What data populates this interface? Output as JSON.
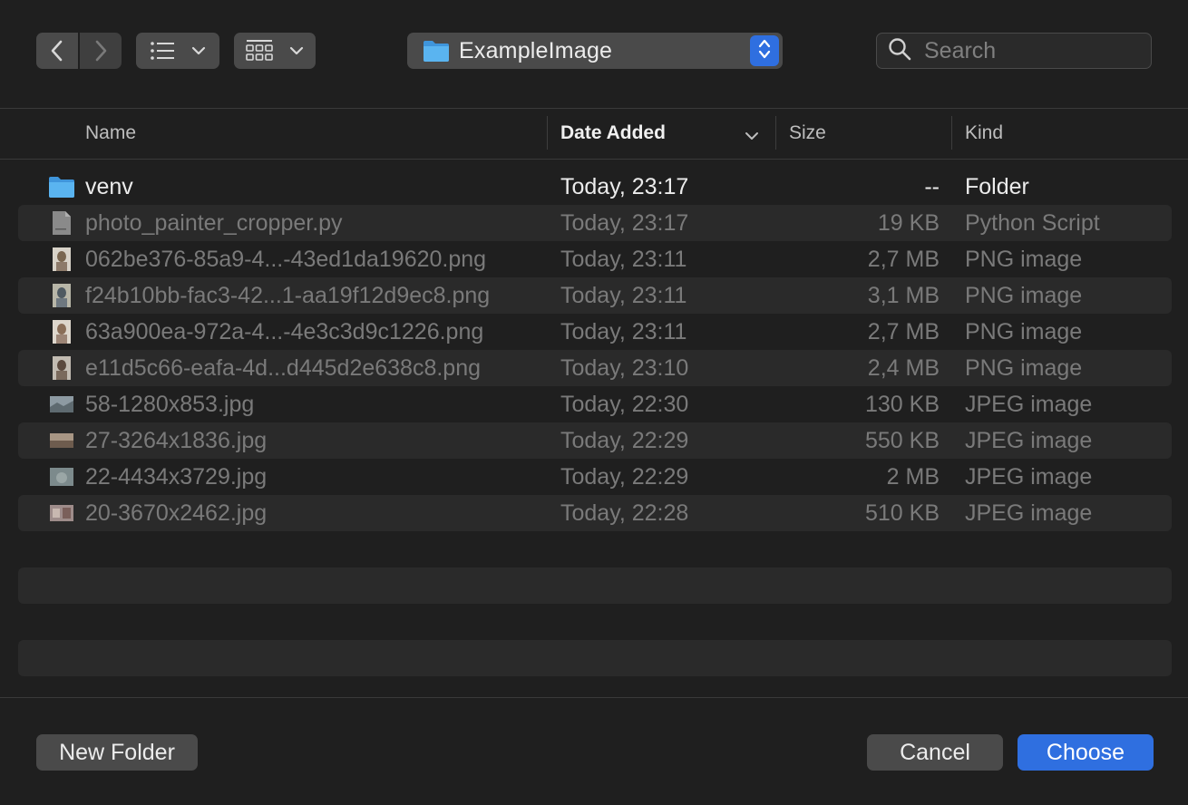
{
  "toolbar": {
    "back_icon": "chevron-left-icon",
    "forward_icon": "chevron-right-icon",
    "list_view_icon": "list-icon",
    "grid_view_icon": "grid-icon",
    "folder": "ExampleImage",
    "search_placeholder": "Search"
  },
  "columns": {
    "name": "Name",
    "date_added": "Date Added",
    "size": "Size",
    "kind": "Kind"
  },
  "files": [
    {
      "name": "venv",
      "date": "Today, 23:17",
      "size": "--",
      "kind": "Folder",
      "icon": "folder-icon",
      "enabled": true
    },
    {
      "name": "photo_painter_cropper.py",
      "date": "Today, 23:17",
      "size": "19 KB",
      "kind": "Python Script",
      "icon": "document-icon",
      "enabled": false
    },
    {
      "name": "062be376-85a9-4...-43ed1da19620.png",
      "date": "Today, 23:11",
      "size": "2,7 MB",
      "kind": "PNG image",
      "icon": "image-thumbnail-icon",
      "enabled": false
    },
    {
      "name": "f24b10bb-fac3-42...1-aa19f12d9ec8.png",
      "date": "Today, 23:11",
      "size": "3,1 MB",
      "kind": "PNG image",
      "icon": "image-thumbnail-icon",
      "enabled": false
    },
    {
      "name": "63a900ea-972a-4...-4e3c3d9c1226.png",
      "date": "Today, 23:11",
      "size": "2,7 MB",
      "kind": "PNG image",
      "icon": "image-thumbnail-icon",
      "enabled": false
    },
    {
      "name": "e11d5c66-eafa-4d...d445d2e638c8.png",
      "date": "Today, 23:10",
      "size": "2,4 MB",
      "kind": "PNG image",
      "icon": "image-thumbnail-icon",
      "enabled": false
    },
    {
      "name": "58-1280x853.jpg",
      "date": "Today, 22:30",
      "size": "130 KB",
      "kind": "JPEG image",
      "icon": "landscape-thumbnail-icon",
      "enabled": false
    },
    {
      "name": "27-3264x1836.jpg",
      "date": "Today, 22:29",
      "size": "550 KB",
      "kind": "JPEG image",
      "icon": "landscape-thumbnail-icon",
      "enabled": false
    },
    {
      "name": "22-4434x3729.jpg",
      "date": "Today, 22:29",
      "size": "2 MB",
      "kind": "JPEG image",
      "icon": "landscape-thumbnail-icon",
      "enabled": false
    },
    {
      "name": "20-3670x2462.jpg",
      "date": "Today, 22:28",
      "size": "510 KB",
      "kind": "JPEG image",
      "icon": "landscape-thumbnail-icon",
      "enabled": false
    }
  ],
  "buttons": {
    "new_folder": "New Folder",
    "cancel": "Cancel",
    "choose": "Choose"
  },
  "colors": {
    "accent": "#2f6fe0",
    "folder_blue": "#4aa8ec"
  }
}
